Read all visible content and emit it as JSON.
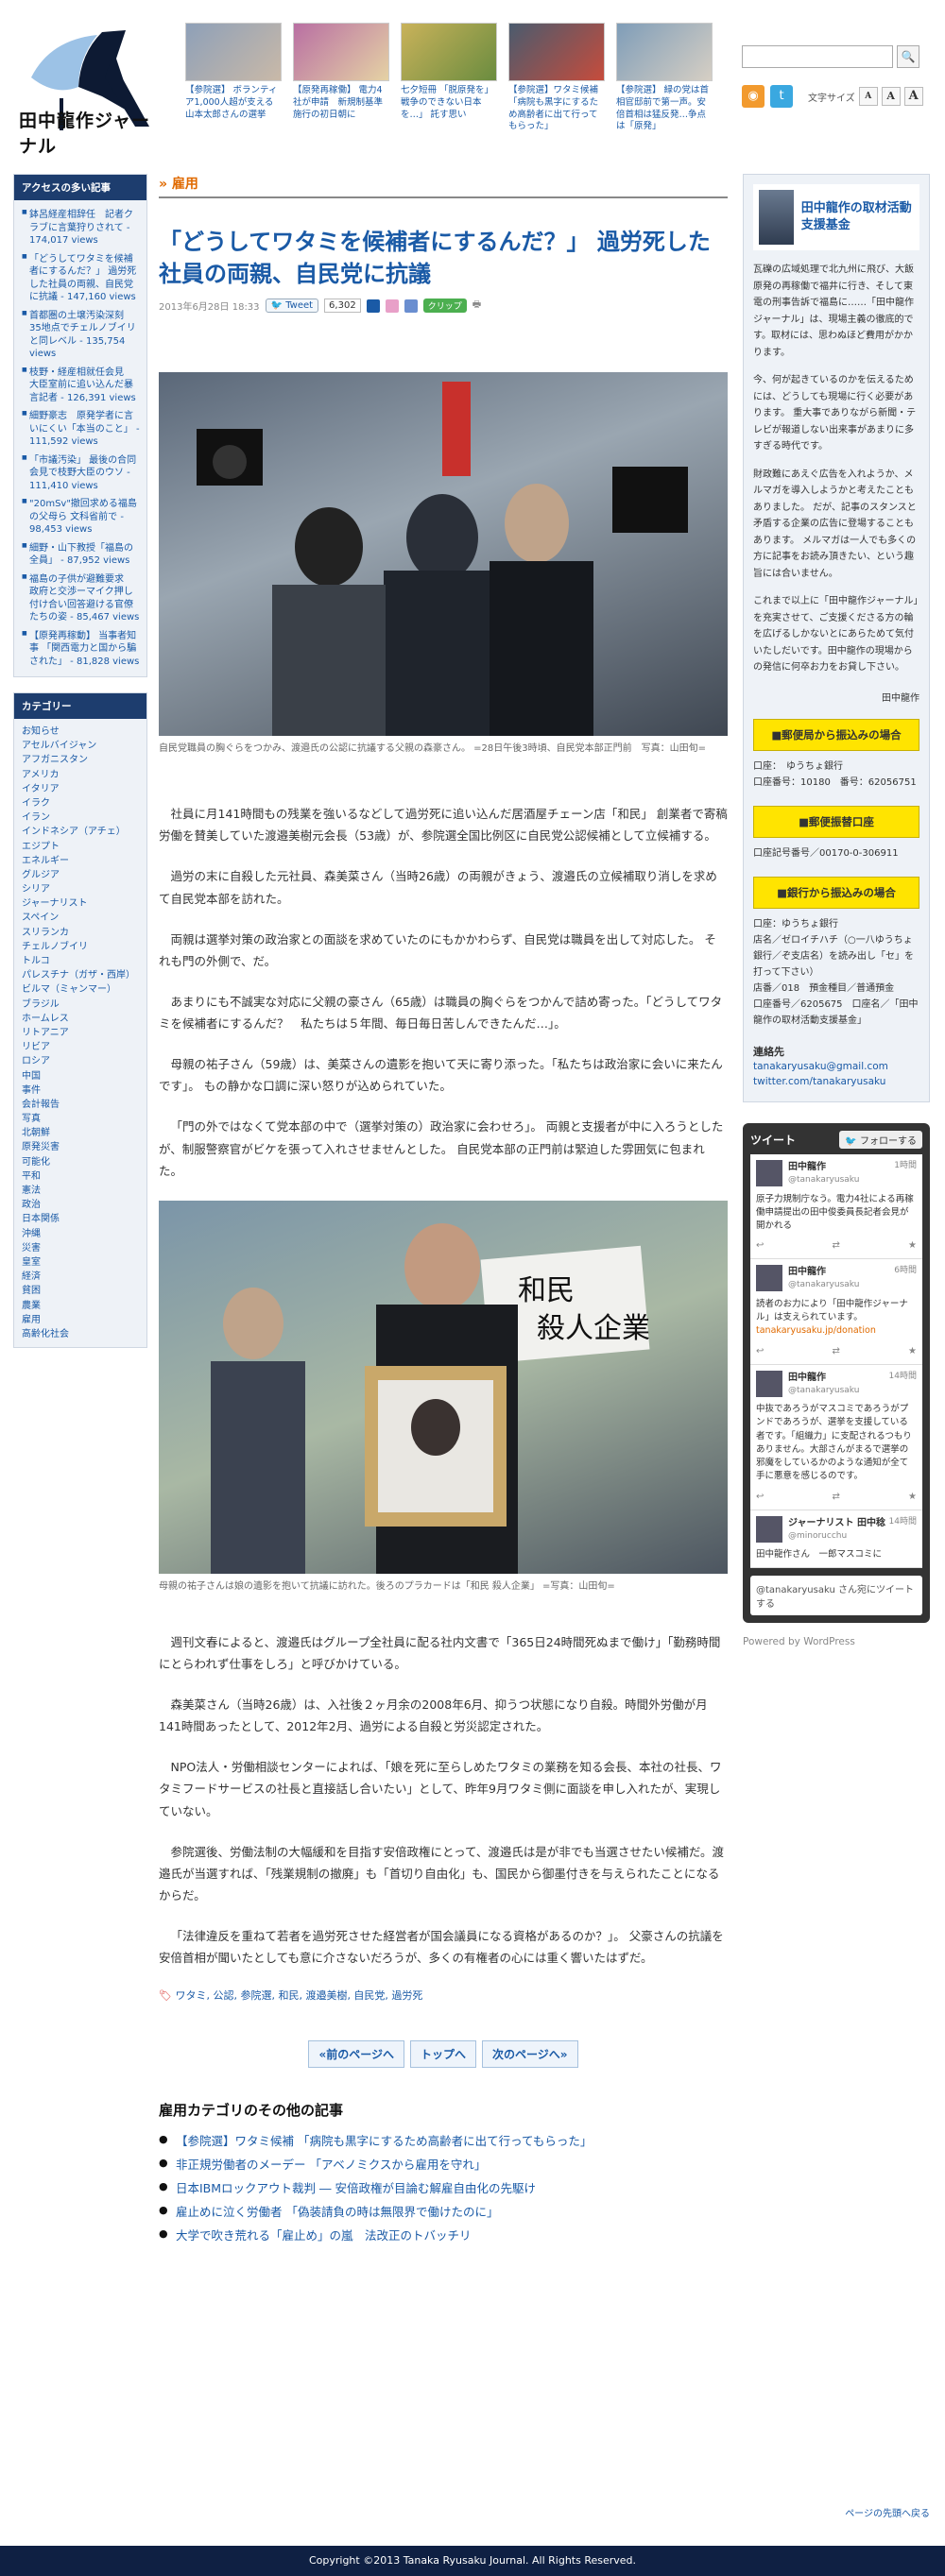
{
  "site": {
    "logo_text": "田中龍作ジャーナル",
    "footer": "Copyright ©2013 Tanaka Ryusaku Journal. All Rights Reserved.",
    "back_to_top": "ページの先頭へ戻る"
  },
  "header": {
    "thumbs": [
      "【参院選】 ボランティア1,000人超が支える山本太郎さんの選挙",
      "【原発再稼働】 電力4社が申請　新規制基準施行の初日朝に",
      "七夕短冊 「脱原発を」 戦争のできない日本を…」 託す思い",
      "【参院選】ワタミ候補 「病院も黒字にするため高齢者に出て行ってもらった」",
      "【参院選】 緑の党は首相官邸前で第一声。安倍首相は猛反発…争点は「原発」"
    ],
    "search_placeholder": "",
    "search_button": "🔍",
    "font_size_label": "文字サイズ",
    "font_sizes": [
      "A",
      "A",
      "A"
    ]
  },
  "left": {
    "ranking_title": "アクセスの多い記事",
    "ranking": [
      "鉢呂経産相辞任　記者クラブに言葉狩りされて - 174,017 views",
      "「どうしてワタミを候補者にするんだ？」 過労死した社員の両親、自民党に抗議 - 147,160 views",
      "首都圏の土壌汚染深刻　35地点でチェルノブイリと同レベル - 135,754 views",
      "枝野・経産相就任会見　大臣室前に追い込んだ暴言記者 - 126,391 views",
      "細野豪志　原発学者に言いにくい「本当のこと」 - 111,592 views",
      "「市議汚染」 最後の合同会見で枝野大臣のウソ - 111,410 views",
      "\"20mSv\"撤回求める福島の父母ら 文科省前で - 98,453 views",
      "細野・山下教授「福島の全員」 - 87,952 views",
      "福島の子供が避難要求　政府と交渉ーマイク押し付け合い回答避ける官僚たちの姿 - 85,467 views",
      "【原発再稼動】 当事者知事 「関西電力と国から騙された」 - 81,828 views"
    ],
    "category_title": "カテゴリー",
    "categories": [
      "お知らせ",
      "アセルバイジャン",
      "アフガニスタン",
      "アメリカ",
      "イタリア",
      "イラク",
      "イラン",
      "インドネシア（アチェ）",
      "エジプト",
      "エネルギー",
      "グルジア",
      "シリア",
      "ジャーナリスト",
      "スペイン",
      "スリランカ",
      "チェルノブイリ",
      "トルコ",
      "パレスチナ（ガザ・西岸）",
      "ビルマ（ミャンマー）",
      "ブラジル",
      "ホームレス",
      "リトアニア",
      "リビア",
      "ロシア",
      "中国",
      "事件",
      "会計報告",
      "写真",
      "北朝鮮",
      "原発災害",
      "可能化",
      "平和",
      "憲法",
      "政治",
      "日本関係",
      "沖縄",
      "災害",
      "皇室",
      "経済",
      "貧困",
      "農業",
      "雇用",
      "高齢化社会"
    ]
  },
  "article": {
    "category": "雇用",
    "title": "「どうしてワタミを候補者にするんだ？」 過労死した社員の両親、自民党に抗議",
    "date": "2013年6月28日 18:33",
    "tweet_label": "Tweet",
    "tweet_count": "6,302",
    "clip_label": "クリップ",
    "photo1_caption": "自民党職員の胸ぐらをつかみ、渡邉氏の公認に抗議する父親の森豪さん。 =28日午後3時頃、自民党本部正門前　写真：山田旬=",
    "photo2_caption": "母親の祐子さんは娘の遺影を抱いて抗議に訪れた。後ろのプラカードは「和民 殺人企業」 =写真：山田旬=",
    "paragraphs_a": [
      "社員に月141時間もの残業を強いるなどして過労死に追い込んだ居酒屋チェーン店「和民」 創業者で寄稿労働を賛美していた渡邉美樹元会長（53歳）が、参院選全国比例区に自民党公認候補として立候補する。",
      "過労の末に自殺した元社員、森美菜さん（当時26歳）の両親がきょう、渡邉氏の立候補取り消しを求めて自民党本部を訪れた。",
      "両親は選挙対策の政治家との面談を求めていたのにもかかわらず、自民党は職員を出して対応した。 それも門の外側で、だ。",
      "あまりにも不誠実な対応に父親の豪さん（65歳）は職員の胸ぐらをつかんで詰め寄った。「どうしてワタミを候補者にするんだ？　私たちは５年間、毎日毎日苦しんできたんだ…」。",
      "母親の祐子さん（59歳）は、美菜さんの遺影を抱いて天に寄り添った。「私たちは政治家に会いに来たんです」。 もの静かな口調に深い怒りが込められていた。",
      "「門の外ではなくて党本部の中で（選挙対策の）政治家に会わせろ」。 両親と支援者が中に入ろうとしたが、制服警察官がビケを張って入れさせませんとした。 自民党本部の正門前は緊迫した雰囲気に包まれた。"
    ],
    "paragraphs_b": [
      "週刊文春によると、渡邉氏はグループ全社員に配る社内文書で「365日24時間死ぬまで働け」「勤務時間にとらわれず仕事をしろ」と呼びかけている。",
      "森美菜さん（当時26歳）は、入社後２ヶ月余の2008年6月、抑うつ状態になり自殺。時間外労働が月141時間あったとして、2012年2月、過労による自殺と労災認定された。",
      "NPO法人・労働相談センターによれば、「娘を死に至らしめたワタミの業務を知る会長、本社の社長、ワタミフードサービスの社長と直接話し合いたい」として、昨年9月ワタミ側に面談を申し入れたが、実現していない。",
      "参院選後、労働法制の大幅緩和を目指す安倍政権にとって、渡邉氏は是が非でも当選させたい候補だ。渡邉氏が当選すれば、「残業規制の撤廃」も「首切り自由化」も、国民から御墨付きを与えられたことになるからだ。",
      "「法律違反を重ねて若者を過労死させた経営者が国会議員になる資格があるのか？」。 父豪さんの抗議を安倍首相が聞いたとしても意に介さないだろうが、多くの有権者の心には重く響いたはずだ。"
    ],
    "tags": "ワタミ, 公認, 参院選, 和民, 渡邉美樹, 自民党, 過労死",
    "pager": [
      "«前のページへ",
      "トップへ",
      "次のページへ»"
    ],
    "related_title": "雇用カテゴリのその他の記事",
    "related": [
      "【参院選】ワタミ候補 「病院も黒字にするため高齢者に出て行ってもらった」",
      "非正規労働者のメーデー 「アベノミクスから雇用を守れ」",
      "日本IBMロックアウト裁判 ― 安倍政権が目論む解雇自由化の先駆け",
      "雇止めに泣く労働者 「偽装請負の時は無限界で働けたのに」",
      "大学で吹き荒れる「雇止め」の嵐　法改正のトバッチリ"
    ]
  },
  "right": {
    "support_title": "田中龍作の取材活動支援基金",
    "support_text": [
      "瓦礫の広域処理で北九州に飛び、大飯原発の再稼働で福井に行き、そして東電の刑事告訴で福島に……「田中龍作ジャーナル」は、現場主義の徹底的です。取材には、思わぬほど費用がかかります。",
      "今、何が起きているのかを伝えるためには、どうしても現場に行く必要があります。 重大事でありながら新聞・テレビが報道しない出来事があまりに多すぎる時代です。",
      "財政難にあえぐ広告を入れようか、メルマガを導入しようかと考えたこともありました。 だが、記事のスタンスと矛盾する企業の広告に登場することもあります。 メルマガは一人でも多くの方に記事をお読み頂きたい、という趣旨には合いません。",
      "これまで以上に「田中龍作ジャーナル」を充実させて、ご支援くださる方の輪を広げるしかないとにあらためて気付いたしだいです。田中龍作の現場からの発信に何卒お力をお貸し下さい。"
    ],
    "support_sign": "田中龍作",
    "pay1": "■郵便局から振込みの場合",
    "pay1_detail": [
      "口座：　ゆうちょ銀行",
      "口座番号：10180　番号：62056751"
    ],
    "pay2": "■郵便振替口座",
    "pay2_detail": [
      "口座記号番号／00170-0-306911"
    ],
    "pay3": "■銀行から振込みの場合",
    "pay3_detail": [
      "口座：ゆうちょ銀行",
      "店名／ゼロイチハチ（○一八ゆうちょ銀行／ぞ支店名）を読み出し「セ」を打って下さい）",
      "店番／018　預金種目／普通預金",
      "口座番号／6205675　口座名／「田中龍作の取材活動支援基金」"
    ],
    "contact_title": "連絡先",
    "contact": [
      "tanakaryusaku@gmail.com",
      "twitter.com/tanakaryusaku"
    ],
    "tw_title": "ツイート",
    "tw_follow": "フォローする",
    "tweets": [
      {
        "name": "田中龍作",
        "handle": "@tanakaryusaku",
        "time": "1時間",
        "text": "原子力規制庁なう。電力4社による再稼働申請提出の田中俊委員長記者会見が開かれる"
      },
      {
        "name": "田中龍作",
        "handle": "@tanakaryusaku",
        "time": "6時間",
        "text": "読者のお力により「田中龍作ジャーナル」は支えられています。",
        "link": "tanakaryusaku.jp/donation"
      },
      {
        "name": "田中龍作",
        "handle": "@tanakaryusaku",
        "time": "14時間",
        "text": "中抜であろうがマスコミであろうがプンドであろうが、選挙を支援している者です。「組織力」に支配されるつもりありません。大部さんがまるで選挙の邪魔をしているかのような通知が全て手に悪意を感じるのです。"
      },
      {
        "name": "ジャーナリスト 田中稔",
        "handle": "@minorucchu",
        "time": "14時間",
        "text": "田中龍作さん　一郎マスコミに"
      }
    ],
    "tw_reply": "@tanakaryusaku さん宛にツイートする",
    "powered": "Powered by WordPress"
  }
}
